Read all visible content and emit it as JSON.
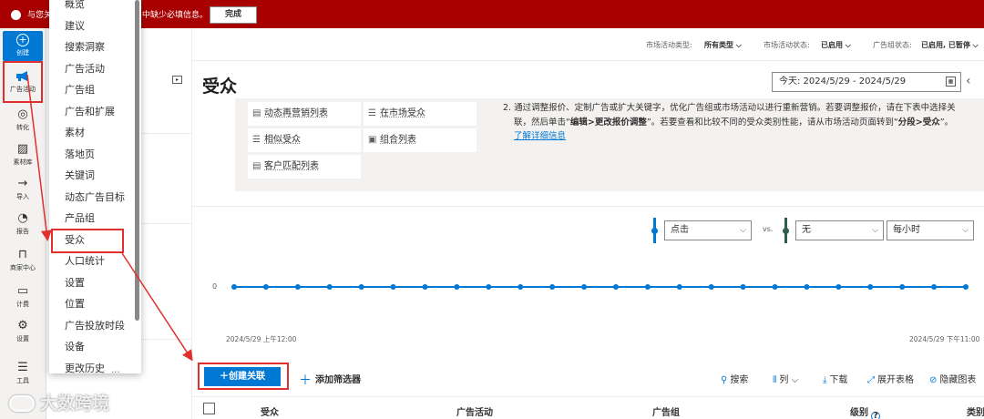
{
  "banner": {
    "text_left": "与您关",
    "text_right": "中缺少必填信息。",
    "done_label": "完成"
  },
  "rail": [
    {
      "label": "创建",
      "icon": "plus-circle-icon"
    },
    {
      "label": "广告活动",
      "icon": "megaphone-icon"
    },
    {
      "label": "转化",
      "icon": "target-icon"
    },
    {
      "label": "素材库",
      "icon": "image-icon"
    },
    {
      "label": "导入",
      "icon": "import-icon"
    },
    {
      "label": "报告",
      "icon": "chart-icon"
    },
    {
      "label": "商家中心",
      "icon": "bag-icon"
    },
    {
      "label": "计费",
      "icon": "wallet-icon"
    },
    {
      "label": "设置",
      "icon": "gear-icon"
    },
    {
      "label": "工具",
      "icon": "tools-icon"
    }
  ],
  "menu": {
    "items": [
      "概览",
      "建议",
      "搜索洞察",
      "广告活动",
      "广告组",
      "广告和扩展",
      "素材",
      "落地页",
      "关键词",
      "动态广告目标",
      "产品组",
      "受众",
      "人口统计",
      "设置",
      "位置",
      "广告投放时段",
      "设备",
      "更改历史"
    ],
    "selected": "受众"
  },
  "filters": {
    "campaign_type_label": "市场活动类型:",
    "campaign_type_value": "所有类型",
    "campaign_status_label": "市场活动状态:",
    "campaign_status_value": "已启用",
    "adgroup_status_label": "广告组状态:",
    "adgroup_status_value": "已启用, 已暂停"
  },
  "page": {
    "title": "受众",
    "date_range": "今天: 2024/5/29 - 2024/5/29"
  },
  "audience_types": [
    {
      "label": "动态再营销列表",
      "icon": "list-icon"
    },
    {
      "label": "在市场受众",
      "icon": "list-lines-icon"
    },
    {
      "label": "相似受众",
      "icon": "list-lines-icon"
    },
    {
      "label": "组合列表",
      "icon": "combined-list-icon"
    },
    {
      "label": "客户匹配列表",
      "icon": "customer-list-icon"
    }
  ],
  "info": {
    "line1": "2. 通过调整报价、定制广告或扩大关键字，优化广告组或市场活动以进行重新营销。若要调整报价，请在下表中选择关",
    "line2_a": "联，然后单击“",
    "line2_b": "编辑>更改报价调整",
    "line2_c": "”。若要查看和比较不同的受众类别性能，请从市场活动页面转到“",
    "line2_d": "分段>受众",
    "line2_e": "”。",
    "link": "了解详细信息"
  },
  "chart_controls": {
    "metric1": "点击",
    "vs": "vs.",
    "metric2": "无",
    "granularity": "每小时",
    "metric1_color": "#0078d4",
    "metric2_color": "#2f5d50"
  },
  "chart_data": {
    "type": "line",
    "series": [
      {
        "name": "点击",
        "values": [
          0,
          0,
          0,
          0,
          0,
          0,
          0,
          0,
          0,
          0,
          0,
          0,
          0,
          0,
          0,
          0,
          0,
          0,
          0,
          0,
          0,
          0,
          0,
          0
        ]
      }
    ],
    "ylim": [
      0,
      0
    ],
    "x_start_label": "2024/5/29 上午12:00",
    "x_end_label": "2024/5/29 下午11:00",
    "y_tick": "0"
  },
  "toolbar": {
    "create_label": "创建关联",
    "add_filter_label": "添加筛选器",
    "search_label": "搜索",
    "columns_label": "列",
    "download_label": "下载",
    "expand_label": "展开表格",
    "hide_chart_label": "隐藏图表"
  },
  "table": {
    "headers": [
      "受众",
      "广告活动",
      "广告组",
      "级别",
      "类别"
    ]
  },
  "watermark": "大数跨境"
}
